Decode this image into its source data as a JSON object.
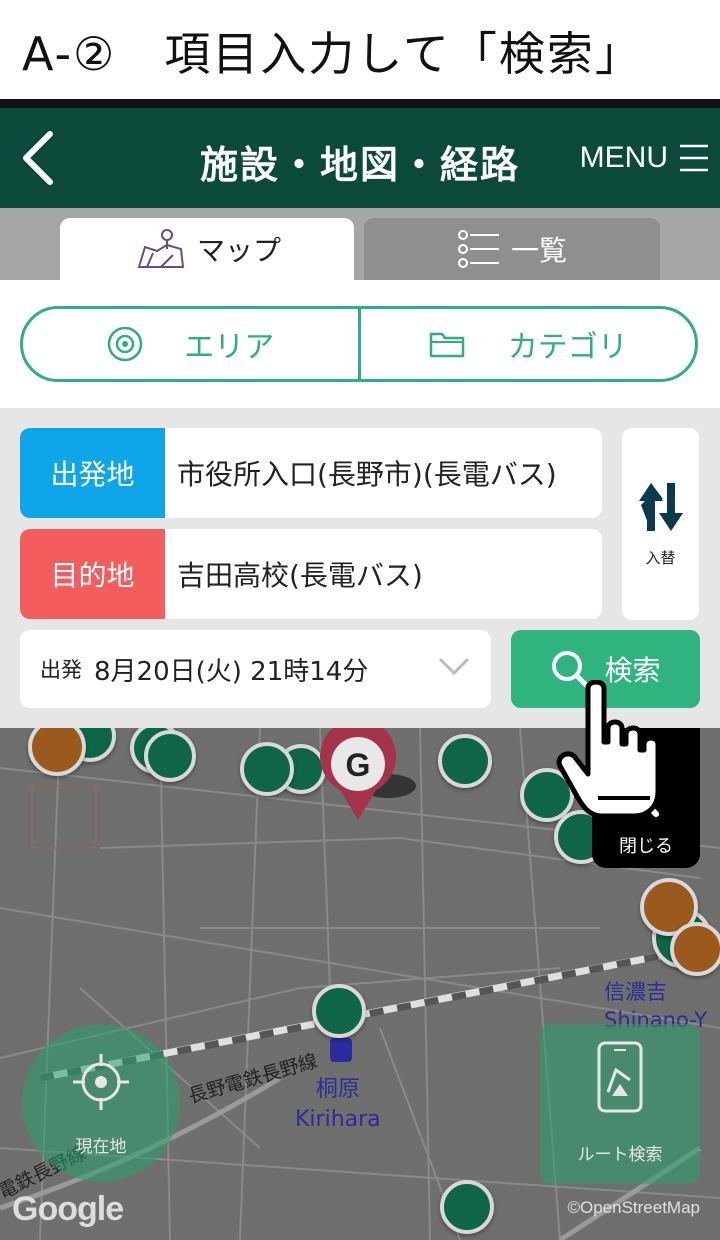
{
  "caption": {
    "text": "A-②　項目入力して「検索」"
  },
  "header": {
    "title": "施設・地図・経路",
    "menu_label": "MENU"
  },
  "tabs": [
    {
      "label": "マップ",
      "icon": "map-icon",
      "active": true
    },
    {
      "label": "一覧",
      "icon": "list-icon",
      "active": false
    }
  ],
  "filters": {
    "area_label": "エリア",
    "category_label": "カテゴリ"
  },
  "route": {
    "from_label": "出発地",
    "from_value": "市役所入口(長野市)(長電バス)",
    "to_label": "目的地",
    "to_value": "吉田高校(長電バス)",
    "swap_label": "入替",
    "date_prefix": "出発",
    "datetime": "8月20日(火) 21時14分",
    "search_label": "検索"
  },
  "colors": {
    "header_bg": "#0b4a3a",
    "accent": "#2fae80",
    "from_color": "#0ea5e9",
    "to_color": "#f45d5d",
    "search_bg": "#2fb37f"
  },
  "map": {
    "goal_marker": "G",
    "close_label": "閉じる",
    "station_jp": "桐原",
    "station_en": "Kirihara",
    "rail_line": "長野電鉄長野線",
    "rail_line_2": "電鉄長野線",
    "area_jp": "信濃吉",
    "area_en": "Shinano-Y",
    "current_location_label": "現在地",
    "route_search_label": "ルート検索",
    "google_label": "Google",
    "osm_credit": "©OpenStreetMap"
  }
}
